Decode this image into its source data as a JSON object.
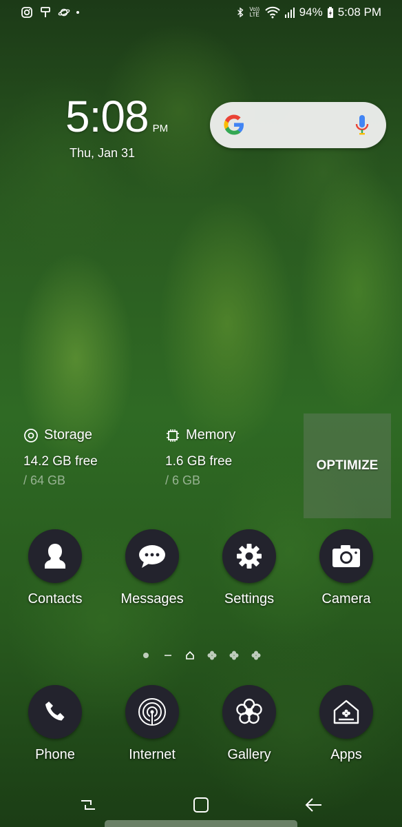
{
  "status_bar": {
    "left_icons": [
      "instagram-icon",
      "hammer-icon",
      "planet-icon",
      "dot-icon"
    ],
    "right_icons": [
      "bluetooth-icon",
      "volte-icon",
      "wifi-icon",
      "signal-icon"
    ],
    "volte_label": "Vo)) LTE",
    "battery": "94%",
    "time": "5:08 PM"
  },
  "clock": {
    "time": "5:08",
    "ampm": "PM",
    "date": "Thu, Jan 31"
  },
  "search": {
    "logo": "google-g-icon",
    "mic": "mic-icon"
  },
  "device_care": {
    "storage": {
      "label": "Storage",
      "free": "14.2 GB free",
      "total": "/ 64 GB"
    },
    "memory": {
      "label": "Memory",
      "free": "1.6 GB free",
      "total": "/ 6 GB"
    },
    "optimize_label": "OPTIMIZE"
  },
  "apps_row": [
    {
      "label": "Contacts",
      "icon": "person-icon"
    },
    {
      "label": "Messages",
      "icon": "chat-bubble-icon"
    },
    {
      "label": "Settings",
      "icon": "gear-icon"
    },
    {
      "label": "Camera",
      "icon": "camera-icon"
    }
  ],
  "dock": [
    {
      "label": "Phone",
      "icon": "phone-icon"
    },
    {
      "label": "Internet",
      "icon": "internet-icon"
    },
    {
      "label": "Gallery",
      "icon": "flower-icon"
    },
    {
      "label": "Apps",
      "icon": "apps-home-icon"
    }
  ],
  "page_indicator": {
    "count": 6,
    "active": 2
  },
  "nav": [
    "recents-icon",
    "home-icon",
    "back-icon"
  ]
}
